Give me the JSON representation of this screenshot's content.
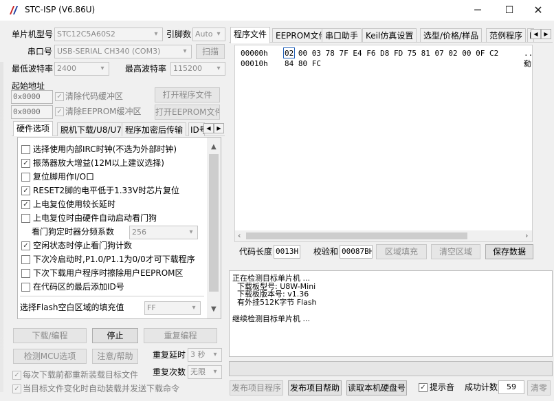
{
  "window": {
    "title": "STC-ISP (V6.86U)",
    "min_glyph": "─",
    "max_glyph": "☐",
    "close_glyph": "✕"
  },
  "left": {
    "mcu_label": "单片机型号",
    "mcu_value": "STC12C5A60S2",
    "pin_label": "引脚数",
    "pin_value": "Auto",
    "port_label": "串口号",
    "port_value": "USB-SERIAL CH340 (COM3)",
    "scan_button": "扫描",
    "min_baud_label": "最低波特率",
    "min_baud_value": "2400",
    "max_baud_label": "最高波特率",
    "max_baud_value": "115200",
    "start_addr_label": "起始地址",
    "code_addr": "0x0000",
    "clear_code_label": "清除代码缓冲区",
    "open_program_button": "打开程序文件",
    "eeprom_addr": "0x0000",
    "clear_eeprom_label": "清除EEPROM缓冲区",
    "open_eeprom_button": "打开EEPROM文件",
    "option_tabs": [
      "硬件选项",
      "脱机下载/U8/U7",
      "程序加密后传输",
      "ID号"
    ],
    "options": [
      {
        "label": "选择使用内部IRC时钟(不选为外部时钟)",
        "checked": false
      },
      {
        "label": "振荡器放大增益(12M以上建议选择)",
        "checked": true
      },
      {
        "label": "复位脚用作I/O口",
        "checked": false
      },
      {
        "label": "RESET2脚的电平低于1.33V时芯片复位",
        "checked": true
      },
      {
        "label": "上电复位使用较长延时",
        "checked": true
      },
      {
        "label": "上电复位时由硬件自动启动看门狗",
        "checked": false
      },
      {
        "label": "空闲状态时停止看门狗计数",
        "checked": true
      },
      {
        "label": "下次冷启动时,P1.0/P1.1为0/0才可下载程序",
        "checked": false
      },
      {
        "label": "下次下载用户程序时擦除用户EEPROM区",
        "checked": false
      },
      {
        "label": "在代码区的最后添加ID号",
        "checked": false
      }
    ],
    "wdt_label": "看门狗定时器分频系数",
    "wdt_value": "256",
    "fill_label": "选择Flash空白区域的填充值",
    "fill_value": "FF",
    "download_button": "下载/编程",
    "stop_button": "停止",
    "reprogram_button": "重复编程",
    "check_mcu_button": "检测MCU选项",
    "help_button": "注意/帮助",
    "repeat_delay_label": "重复延时",
    "repeat_delay_value": "3 秒",
    "repeat_count_label": "重复次数",
    "repeat_count_value": "无限",
    "reload_before_label": "每次下载前都重新装载目标文件",
    "reload_on_change_label": "当目标文件变化时自动装载并发送下载命令"
  },
  "right": {
    "tabs": [
      "程序文件",
      "EEPROM文件",
      "串口助手",
      "Keil仿真设置",
      "选型/价格/样品",
      "范例程序",
      "I"
    ],
    "hex_lines": [
      {
        "addr": "00000h",
        "bytes": "02 00 03 78 7F E4 F6 D8 FD 75 81 07 02 00 0F C2",
        "ascii": "..."
      },
      {
        "addr": "00010h",
        "bytes": "84 80 FC",
        "ascii": "勬"
      }
    ],
    "code_length_label": "代码长度",
    "code_length_value": "0013H",
    "checksum_label": "校验和",
    "checksum_value": "00087BH",
    "fill_area_button": "区域填充",
    "clear_area_button": "清空区域",
    "save_button": "保存数据",
    "log_lines": [
      "正在检测目标单片机 ...",
      "  下载板型号: U8W-Mini",
      "  下载板版本号: v1.36",
      "  有外挂512K字节 Flash",
      "",
      "继续检测目标单片机 ..."
    ],
    "publish_program_button": "发布项目程序",
    "publish_help_button": "发布项目帮助",
    "read_disk_button": "读取本机硬盘号",
    "prompt_sound_label": "提示音",
    "success_count_label": "成功计数",
    "success_count_value": "59",
    "clear_count_button": "清零"
  }
}
